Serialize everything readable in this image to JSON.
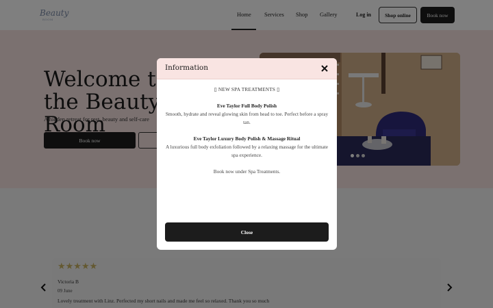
{
  "nav": {
    "logo_text": "Beauty",
    "logo_sub": "ROOM",
    "links": [
      "Home",
      "Services",
      "Shop",
      "Gallery"
    ],
    "login": "Log in",
    "shop_online": "Shop online",
    "book_now": "Book now"
  },
  "hero": {
    "title": "Welcome to the Beauty Room",
    "subtitle": "A hidden retreat for rest, beauty and self-care",
    "book_button": "Book now"
  },
  "review": {
    "stars": "★★★★★",
    "rating": 5,
    "name": "Victoria B",
    "date": "09 June",
    "text": "Lovely treatment with Linz. Perfected my short nails and made me feel so relaxed. Thank you so much"
  },
  "modal": {
    "title": "Information",
    "heading": "▯ NEW SPA TREATMENTS ▯",
    "items": [
      {
        "title": "Eve Taylor Full Body Polish",
        "text": "Smooth, hydrate and reveal glowing skin from head to toe. Perfect before a spray tan."
      },
      {
        "title": "Eve Taylor Luxury Body Polish & Massage Ritual",
        "text": "A luxurious full body exfoliation followed by a relaxing massage for the ultimate spa experience."
      }
    ],
    "footer_note": "Book now under Spa Treatments.",
    "close_label": "Close"
  },
  "carousel": {
    "slide_count": 3,
    "active_index": 0
  },
  "colors": {
    "hero_bg": "#f6e3e1",
    "modal_header_bg": "#f9e4e2",
    "dark_button": "#1c1c1c",
    "star": "#c9b262"
  },
  "icons": {
    "modal_close": "close-icon",
    "carousel_prev": "chevron-left-icon",
    "carousel_next": "chevron-right-icon"
  }
}
